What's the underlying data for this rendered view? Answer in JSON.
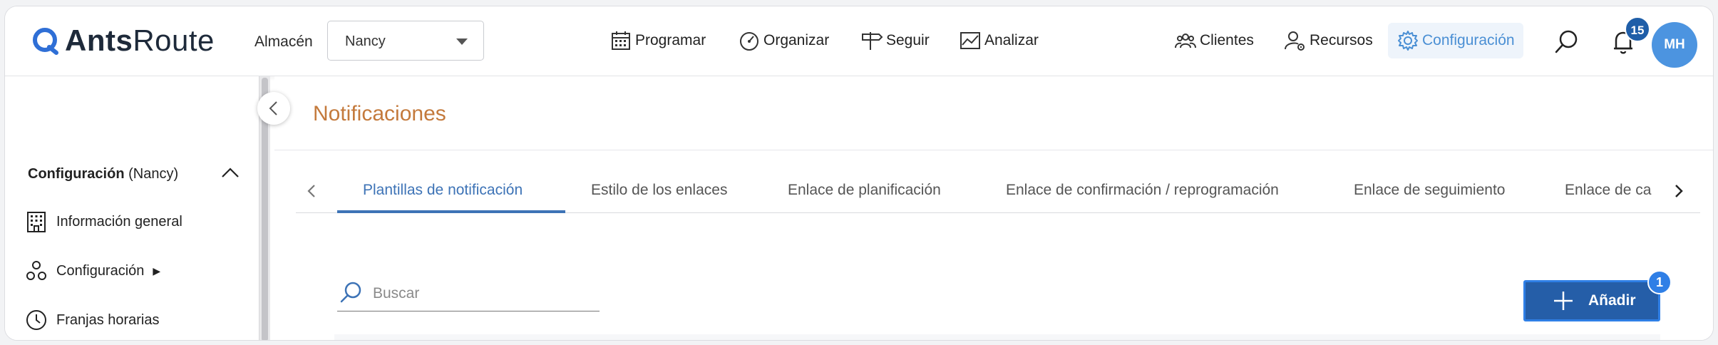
{
  "brand": {
    "name_bold": "Ants",
    "name_light": "Route",
    "logo_color": "#2f6fd6"
  },
  "header": {
    "almacen_label": "Almacén",
    "almacen_value": "Nancy",
    "nav": [
      {
        "label": "Programar",
        "icon": "calendar-icon"
      },
      {
        "label": "Organizar",
        "icon": "speedometer-icon"
      },
      {
        "label": "Seguir",
        "icon": "signpost-icon"
      },
      {
        "label": "Analizar",
        "icon": "chart-icon"
      }
    ],
    "right_nav": [
      {
        "label": "Clientes",
        "icon": "users-icon"
      },
      {
        "label": "Recursos",
        "icon": "user-gear-icon"
      },
      {
        "label": "Configuración",
        "icon": "gear-icon",
        "active": true
      }
    ],
    "notifications_count": "15",
    "avatar_initials": "MH"
  },
  "sidebar": {
    "title_bold": "Configuración",
    "title_rest": " (Nancy)",
    "items": [
      {
        "label": "Información general",
        "icon": "building-icon"
      },
      {
        "label": "Configuración",
        "icon": "cogs-icon",
        "arrow": "▶"
      },
      {
        "label": "Franjas horarias",
        "icon": "clock-icon"
      }
    ]
  },
  "main": {
    "page_title": "Notificaciones",
    "tabs": [
      {
        "label": "Plantillas de notificación",
        "active": true
      },
      {
        "label": "Estilo de los enlaces"
      },
      {
        "label": "Enlace de planificación"
      },
      {
        "label": "Enlace de confirmación / reprogramación"
      },
      {
        "label": "Enlace de seguimiento"
      },
      {
        "label": "Enlace de ca"
      }
    ],
    "search_placeholder": "Buscar",
    "add_label": "Añadir",
    "add_badge": "1"
  },
  "colors": {
    "accent": "#3d73b6",
    "title": "#c47a3c",
    "button": "#255ea8",
    "avatar": "#4c94e0"
  }
}
